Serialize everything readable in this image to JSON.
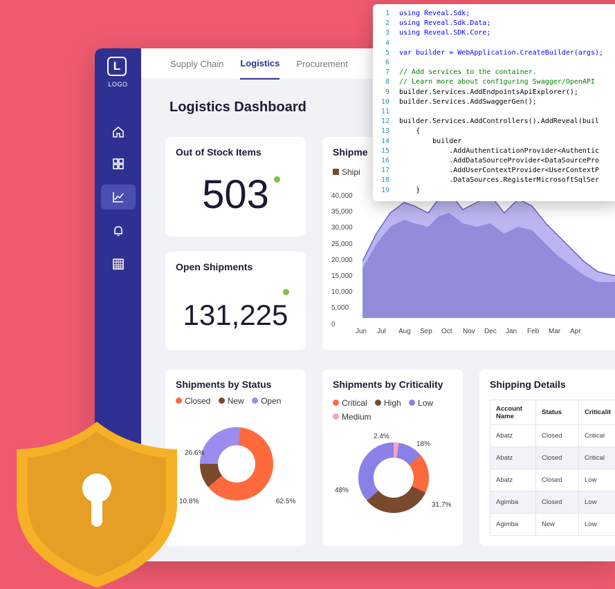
{
  "logo": {
    "letter": "L",
    "text": "LOGO"
  },
  "tabs": [
    {
      "label": "Supply Chain",
      "active": false
    },
    {
      "label": "Logistics",
      "active": true
    },
    {
      "label": "Procurement",
      "active": false
    }
  ],
  "page_title": "Logistics Dashboard",
  "sidebar_icons": [
    "home-icon",
    "grid-icon",
    "chart-icon",
    "bell-icon",
    "calendar-icon"
  ],
  "kpis": {
    "out_of_stock": {
      "title": "Out of Stock Items",
      "value": "503"
    },
    "open_shipments": {
      "title": "Open Shipments",
      "value": "131,225"
    }
  },
  "shipments_chart": {
    "title": "Shipme",
    "legend": "Shipi",
    "y_ticks": [
      "40,000",
      "35,000",
      "30,000",
      "25,000",
      "20,000",
      "15,000",
      "10,000",
      "5,000",
      "0"
    ],
    "x_ticks": [
      "Jun",
      "Jul",
      "Aug",
      "Sep",
      "Oct",
      "Nov",
      "Dec",
      "Jan",
      "Feb",
      "Mar",
      "Apr"
    ]
  },
  "status_card": {
    "title": "Shipments by Status",
    "legend": [
      {
        "label": "Closed",
        "color": "#ff6a3d"
      },
      {
        "label": "New",
        "color": "#7a4a2c"
      },
      {
        "label": "Open",
        "color": "#9c8cf0"
      }
    ],
    "labels": [
      "26.6%",
      "10.8%",
      "62.5%"
    ]
  },
  "criticality_card": {
    "title": "Shipments by Criticality",
    "legend": [
      {
        "label": "Critical",
        "color": "#ff6a3d"
      },
      {
        "label": "High",
        "color": "#7a4a2c"
      },
      {
        "label": "Low",
        "color": "#8b7fe8"
      },
      {
        "label": "Medium",
        "color": "#f2a6c0"
      }
    ],
    "labels": [
      "2.4%",
      "18%",
      "48%",
      "31.7%"
    ]
  },
  "shipping_details": {
    "title": "Shipping Details",
    "headers": [
      "Account Name",
      "Status",
      "Criticalit"
    ],
    "rows": [
      [
        "Abatz",
        "Closed",
        "Critical"
      ],
      [
        "Abatz",
        "Closed",
        "Critical"
      ],
      [
        "Abatz",
        "Closed",
        "Low"
      ],
      [
        "Agimba",
        "Closed",
        "Low"
      ],
      [
        "Agimba",
        "New",
        "Low"
      ]
    ]
  },
  "code_lines": [
    {
      "n": "1",
      "t": "using Reveal.Sdk;"
    },
    {
      "n": "2",
      "t": "using Reveal.Sdk.Data;"
    },
    {
      "n": "3",
      "t": "using Reveal.SDK.Core;"
    },
    {
      "n": "4",
      "t": ""
    },
    {
      "n": "5",
      "t": "var builder = WebApplication.CreateBuilder(args);"
    },
    {
      "n": "6",
      "t": ""
    },
    {
      "n": "7",
      "t": "// Add services to the container."
    },
    {
      "n": "8",
      "t": "// Learn more about configuring Swagger/OpenAPI"
    },
    {
      "n": "9",
      "t": "builder.Services.AddEndpointsApiExplorer();"
    },
    {
      "n": "10",
      "t": "builder.Services.AddSwaggerGen();"
    },
    {
      "n": "11",
      "t": ""
    },
    {
      "n": "12",
      "t": "builder.Services.AddControllers().AddReveal(buil"
    },
    {
      "n": "13",
      "t": "    {"
    },
    {
      "n": "14",
      "t": "        builder"
    },
    {
      "n": "15",
      "t": "            .AddAuthenticationProvider<Authentic"
    },
    {
      "n": "16",
      "t": "            .AddDataSourceProvider<DataSourcePro"
    },
    {
      "n": "17",
      "t": "            .AddUserContextProvider<UserContextP"
    },
    {
      "n": "18",
      "t": "            .DataSources.RegisterMicrosoftSqlSer"
    },
    {
      "n": "19",
      "t": "    }"
    }
  ]
}
